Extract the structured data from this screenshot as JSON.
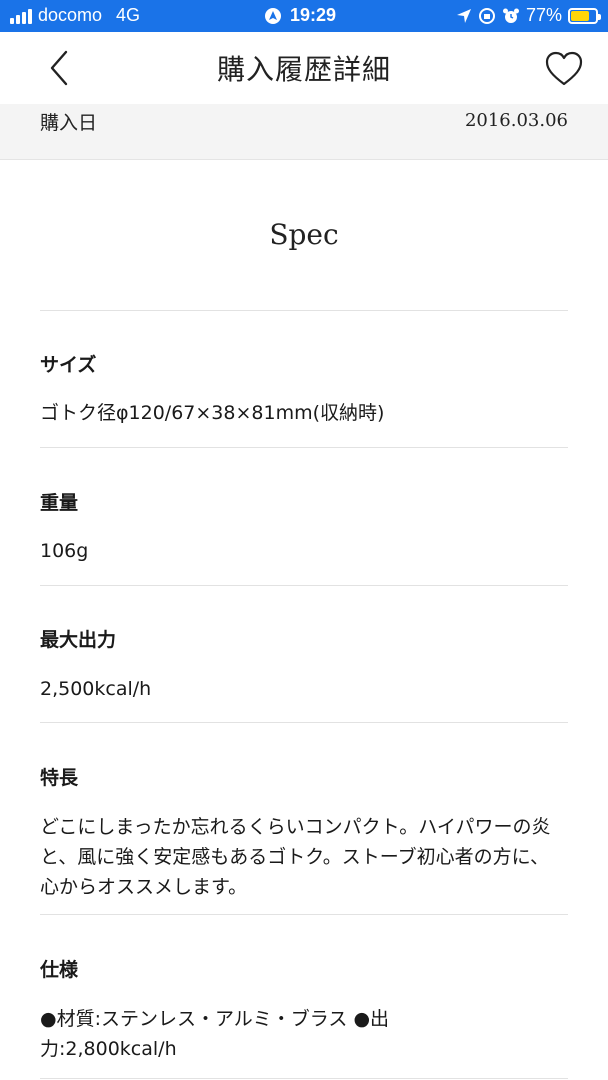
{
  "status_bar": {
    "carrier": "docomo",
    "network": "4G",
    "time": "19:29",
    "battery": "77%",
    "battery_level": 0.77,
    "battery_color": "#ffd60a",
    "background": "#1a73e8"
  },
  "nav": {
    "title": "購入履歴詳細",
    "back_icon": "chevron-left-icon",
    "favorite_icon": "heart-outline-icon"
  },
  "purchase": {
    "label": "購入日",
    "date": "2016.03.06"
  },
  "spec": {
    "heading": "Spec",
    "items": [
      {
        "label": "サイズ",
        "value": "ゴトク径φ120/67×38×81mm(収納時)"
      },
      {
        "label": "重量",
        "value": "106g"
      },
      {
        "label": "最大出力",
        "value": "2,500kcal/h"
      },
      {
        "label": "特長",
        "value": "どこにしまったか忘れるくらいコンパクト。ハイパワーの炎と、風に強く安定感もあるゴトク。ストーブ初心者の方に、心からオススメします。"
      },
      {
        "label": "仕様",
        "value": "●材質:ステンレス・アルミ・ブラス ●出力:2,800kcal/h"
      }
    ]
  }
}
